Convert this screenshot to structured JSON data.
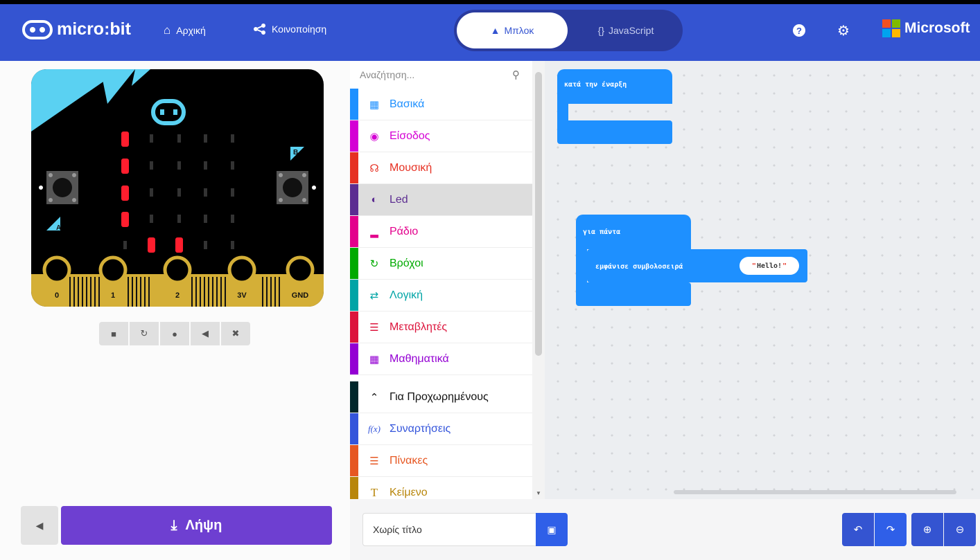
{
  "header": {
    "brand": "micro:bit",
    "home_label": "Αρχική",
    "share_label": "Κοινοποίηση",
    "blocks_tab": "Μπλοκ",
    "js_tab": "JavaScript",
    "ms_label": "Microsoft",
    "colors": {
      "bar": "#3454D1",
      "toggle_bg": "#2a3b9e"
    }
  },
  "simulator": {
    "pins": [
      "0",
      "1",
      "2",
      "3V",
      "GND"
    ],
    "button_a": "A",
    "button_b": "B",
    "toolbar": [
      "stop-icon",
      "restart-icon",
      "slowmo-icon",
      "mute-icon",
      "fullscreen-icon"
    ],
    "collapse_icon": "collapse-icon",
    "download_label": "Λήψη",
    "colors": {
      "board_accent": "#5ad1f2",
      "led_on": "#ff1e2e",
      "gold": "#d4af37",
      "download": "#6e3fd1"
    }
  },
  "toolbox": {
    "search_placeholder": "Αναζήτηση...",
    "categories": [
      {
        "label": "Βασικά",
        "color": "#1e90ff"
      },
      {
        "label": "Είσοδος",
        "color": "#d400d4"
      },
      {
        "label": "Μουσική",
        "color": "#e63022"
      },
      {
        "label": "Led",
        "color": "#5c2d91"
      },
      {
        "label": "Ράδιο",
        "color": "#e3008c"
      },
      {
        "label": "Βρόχοι",
        "color": "#00aa00"
      },
      {
        "label": "Λογική",
        "color": "#00a4a6"
      },
      {
        "label": "Μεταβλητές",
        "color": "#dc143c"
      },
      {
        "label": "Μαθηματικά",
        "color": "#9400d3"
      },
      {
        "label": "Για Προχωρημένους",
        "color": "#00272b"
      },
      {
        "label": "Συναρτήσεις",
        "color": "#3455db"
      },
      {
        "label": "Πίνακες",
        "color": "#e65722"
      },
      {
        "label": "Κείμενο",
        "color": "#b8860b"
      }
    ]
  },
  "workspace": {
    "on_start": "κατά την έναρξη",
    "forever": "για πάντα",
    "show_string": "εμφάνισε συμβολοσειρά",
    "string_value": "Hello!",
    "block_color": "#1e90ff"
  },
  "footer": {
    "project_name": "Χωρίς τίτλο",
    "controls": [
      "undo-icon",
      "redo-icon",
      "zoom-in-icon",
      "zoom-out-icon"
    ]
  }
}
